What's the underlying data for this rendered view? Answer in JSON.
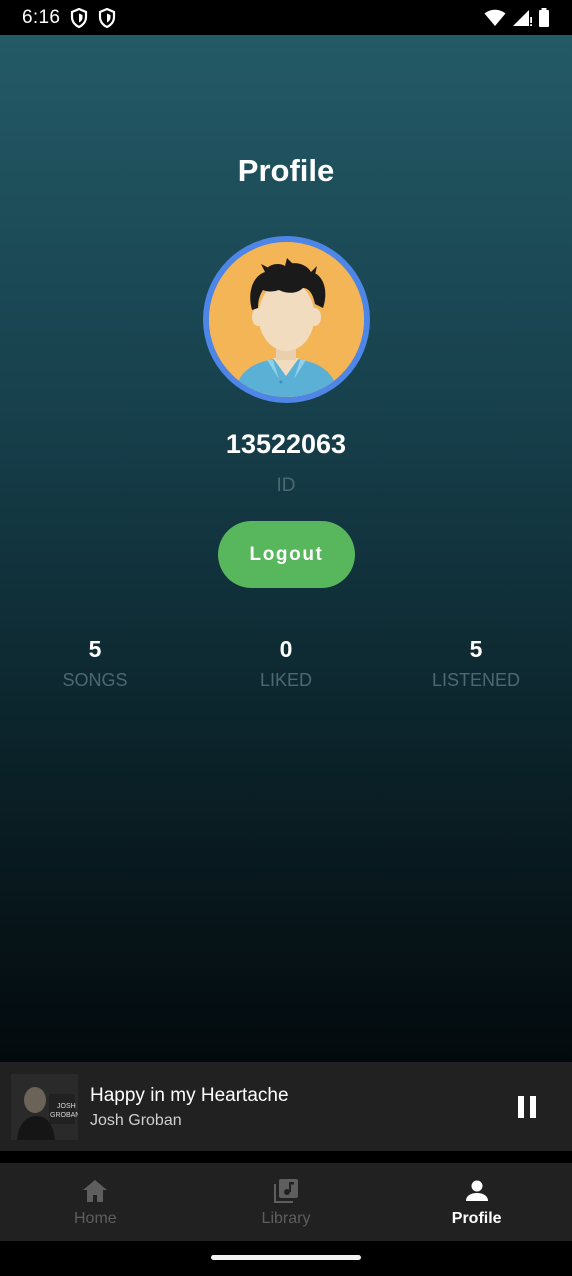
{
  "status_bar": {
    "time": "6:16",
    "left_icons": [
      "shield-icon",
      "shield-icon"
    ],
    "right_icons": [
      "wifi-icon",
      "signal-icon",
      "battery-icon"
    ]
  },
  "profile": {
    "title": "Profile",
    "user_id": "13522063",
    "user_id_label": "ID",
    "logout_label": "Logout",
    "stats": [
      {
        "value": "5",
        "label": "SONGS"
      },
      {
        "value": "0",
        "label": "LIKED"
      },
      {
        "value": "5",
        "label": "LISTENED"
      }
    ]
  },
  "now_playing": {
    "title": "Happy in my Heartache",
    "artist": "Josh Groban",
    "album_art_text": "JOSH GROBAN",
    "state": "playing"
  },
  "bottom_nav": {
    "items": [
      {
        "label": "Home",
        "icon": "home-icon",
        "active": false
      },
      {
        "label": "Library",
        "icon": "library-icon",
        "active": false
      },
      {
        "label": "Profile",
        "icon": "person-icon",
        "active": true
      }
    ]
  },
  "colors": {
    "avatar_ring": "#4d86e6",
    "avatar_background": "#f3b556",
    "logout_button": "#58b65d",
    "muted_label": "#4d6870",
    "panel_background": "#212121"
  }
}
